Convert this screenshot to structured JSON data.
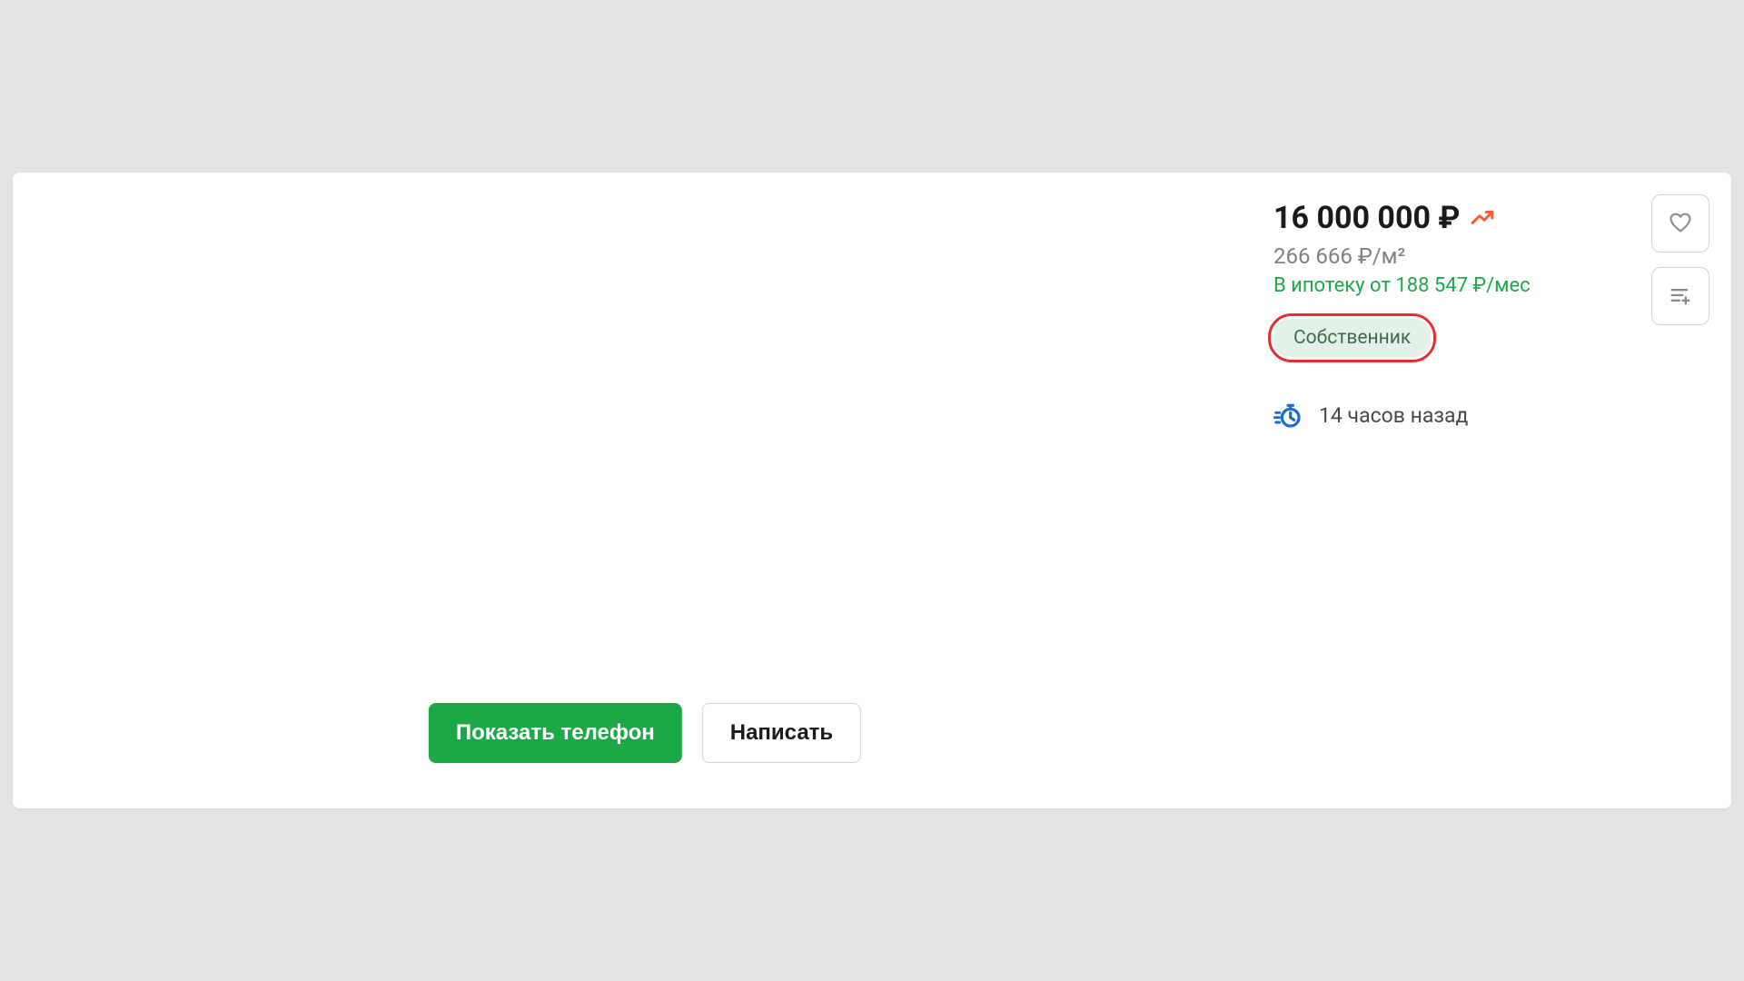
{
  "listing": {
    "price": "16 000 000 ₽",
    "price_per_unit": "266 666 ₽/м²",
    "mortgage": "В ипотеку от 188 547 ₽/мес",
    "owner_badge": "Собственник",
    "time_posted": "14 часов назад"
  },
  "actions": {
    "show_phone": "Показать телефон",
    "write": "Написать"
  }
}
